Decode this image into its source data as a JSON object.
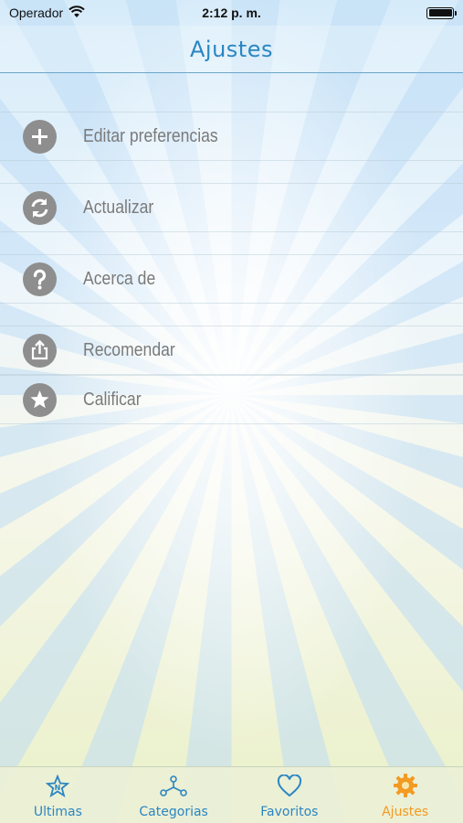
{
  "status_bar": {
    "carrier": "Operador",
    "time": "2:12 p. m."
  },
  "nav": {
    "title": "Ajustes"
  },
  "menu": [
    {
      "label": "Editar preferencias",
      "icon": "plus-icon"
    },
    {
      "label": "Actualizar",
      "icon": "refresh-icon"
    },
    {
      "label": "Acerca de",
      "icon": "question-icon"
    },
    {
      "label": "Recomendar",
      "icon": "share-icon"
    },
    {
      "label": "Calificar",
      "icon": "star-icon"
    }
  ],
  "tabs": [
    {
      "label": "Ultimas",
      "icon": "new-star-icon"
    },
    {
      "label": "Categorias",
      "icon": "network-icon"
    },
    {
      "label": "Favoritos",
      "icon": "heart-icon"
    },
    {
      "label": "Ajustes",
      "icon": "gear-icon",
      "active": true
    }
  ],
  "colors": {
    "accent": "#2a86c2",
    "active_tab": "#f39a22",
    "icon_gray": "#8e8e8e"
  }
}
